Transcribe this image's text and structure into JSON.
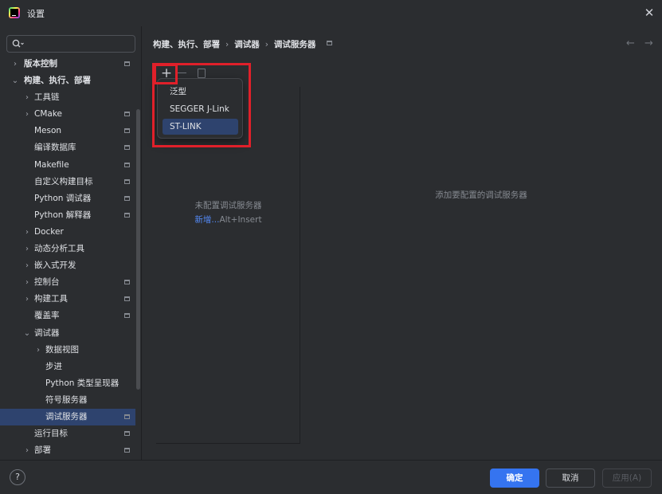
{
  "window": {
    "title": "设置",
    "close_glyph": "✕"
  },
  "search": {
    "value": "",
    "placeholder": ""
  },
  "sidebar": {
    "items": [
      {
        "label": "版本控制",
        "bold": true,
        "chev": "›",
        "indent": 0,
        "page": true
      },
      {
        "label": "构建、执行、部署",
        "bold": true,
        "chev": "⌄",
        "indent": 0,
        "page": false
      },
      {
        "label": "工具链",
        "chev": "›",
        "indent": 1,
        "page": false
      },
      {
        "label": "CMake",
        "chev": "›",
        "indent": 1,
        "page": true
      },
      {
        "label": "Meson",
        "chev": "",
        "indent": 1,
        "page": true
      },
      {
        "label": "编译数据库",
        "chev": "",
        "indent": 1,
        "page": true
      },
      {
        "label": "Makefile",
        "chev": "",
        "indent": 1,
        "page": true
      },
      {
        "label": "自定义构建目标",
        "chev": "",
        "indent": 1,
        "page": true
      },
      {
        "label": "Python 调试器",
        "chev": "",
        "indent": 1,
        "page": true
      },
      {
        "label": "Python 解释器",
        "chev": "",
        "indent": 1,
        "page": true
      },
      {
        "label": "Docker",
        "chev": "›",
        "indent": 1,
        "page": false
      },
      {
        "label": "动态分析工具",
        "chev": "›",
        "indent": 1,
        "page": false
      },
      {
        "label": "嵌入式开发",
        "chev": "›",
        "indent": 1,
        "page": false
      },
      {
        "label": "控制台",
        "chev": "›",
        "indent": 1,
        "page": true
      },
      {
        "label": "构建工具",
        "chev": "›",
        "indent": 1,
        "page": true
      },
      {
        "label": "覆盖率",
        "chev": "",
        "indent": 1,
        "page": true
      },
      {
        "label": "调试器",
        "chev": "⌄",
        "indent": 1,
        "page": false
      },
      {
        "label": "数据视图",
        "chev": "›",
        "indent": 2,
        "page": false
      },
      {
        "label": "步进",
        "chev": "",
        "indent": 2,
        "page": false
      },
      {
        "label": "Python 类型呈现器",
        "chev": "",
        "indent": 2,
        "page": false
      },
      {
        "label": "符号服务器",
        "chev": "",
        "indent": 2,
        "page": false
      },
      {
        "label": "调试服务器",
        "chev": "",
        "indent": 2,
        "page": true,
        "selected": true
      },
      {
        "label": "运行目标",
        "chev": "",
        "indent": 1,
        "page": true
      },
      {
        "label": "部署",
        "chev": "›",
        "indent": 1,
        "page": true
      }
    ]
  },
  "breadcrumb": {
    "items": [
      "构建、执行、部署",
      "调试器",
      "调试服务器"
    ],
    "sep": "›"
  },
  "nav": {
    "back": "←",
    "forward": "→"
  },
  "toolbar": {
    "add": "+",
    "remove": "−",
    "copy": ""
  },
  "list_panel": {
    "empty_message": "未配置调试服务器",
    "new_link": "新增...",
    "shortcut": "Alt+Insert"
  },
  "detail": {
    "message": "添加要配置的调试服务器"
  },
  "popup": {
    "items": [
      {
        "label": "泛型",
        "active": false
      },
      {
        "label": "SEGGER J-Link",
        "active": false
      },
      {
        "label": "ST-LINK",
        "active": true
      }
    ]
  },
  "highlight": {
    "color": "#e0202a"
  },
  "footer": {
    "help": "?",
    "ok": "确定",
    "cancel": "取消",
    "apply": "应用(A)"
  },
  "colors": {
    "accent": "#3574f0",
    "selection": "#2e436e",
    "link": "#548af7",
    "background": "#2b2d30"
  }
}
